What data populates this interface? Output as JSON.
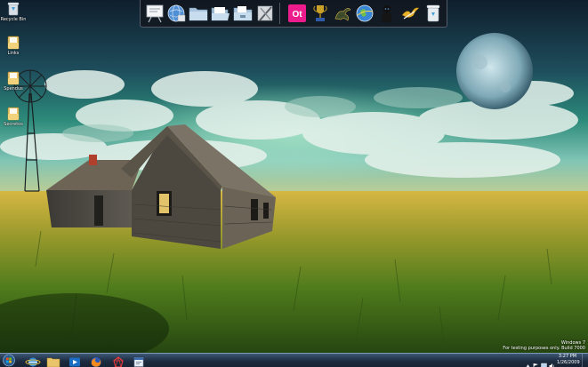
{
  "desktop_icons": [
    {
      "label": "Recycle Bin",
      "icon": "recycle-bin-icon"
    },
    {
      "label": "Links",
      "icon": "folder-icon"
    },
    {
      "label": "Spendus",
      "icon": "folder-icon"
    },
    {
      "label": "Secretos",
      "icon": "folder-icon"
    }
  ],
  "dock": {
    "items": [
      {
        "icon": "presentation-board-icon"
      },
      {
        "icon": "globe-network-icon"
      },
      {
        "icon": "folder-icon"
      },
      {
        "icon": "open-folder-icon"
      },
      {
        "icon": "folder-documents-icon"
      },
      {
        "icon": "tools-icon"
      },
      {
        "icon": "ot-app-icon",
        "label": "Ot"
      },
      {
        "icon": "trophy-icon"
      },
      {
        "icon": "dragon-icon"
      },
      {
        "icon": "internet-globe-icon"
      },
      {
        "icon": "dark-figure-icon"
      },
      {
        "icon": "bird-icon"
      },
      {
        "icon": "trash-can-icon"
      }
    ]
  },
  "watermark": {
    "line1": "Windows 7",
    "line2": "For testing purposes only. Build 7000"
  },
  "taskbar": {
    "start_icon": "windows-start-orb-icon",
    "apps": [
      {
        "icon": "internet-explorer-icon"
      },
      {
        "icon": "file-explorer-icon"
      },
      {
        "icon": "media-player-icon"
      },
      {
        "icon": "firefox-icon"
      },
      {
        "icon": "red-shape-app-icon"
      },
      {
        "icon": "document-window-icon"
      }
    ],
    "tray_icons": [
      "expand-tray-icon",
      "flag-icon",
      "network-icon",
      "volume-icon"
    ],
    "clock": {
      "time": "3:27 PM",
      "date": "1/26/2009"
    }
  },
  "colors": {
    "taskbar": "#1d2c40",
    "accent": "#ec1c8c"
  }
}
